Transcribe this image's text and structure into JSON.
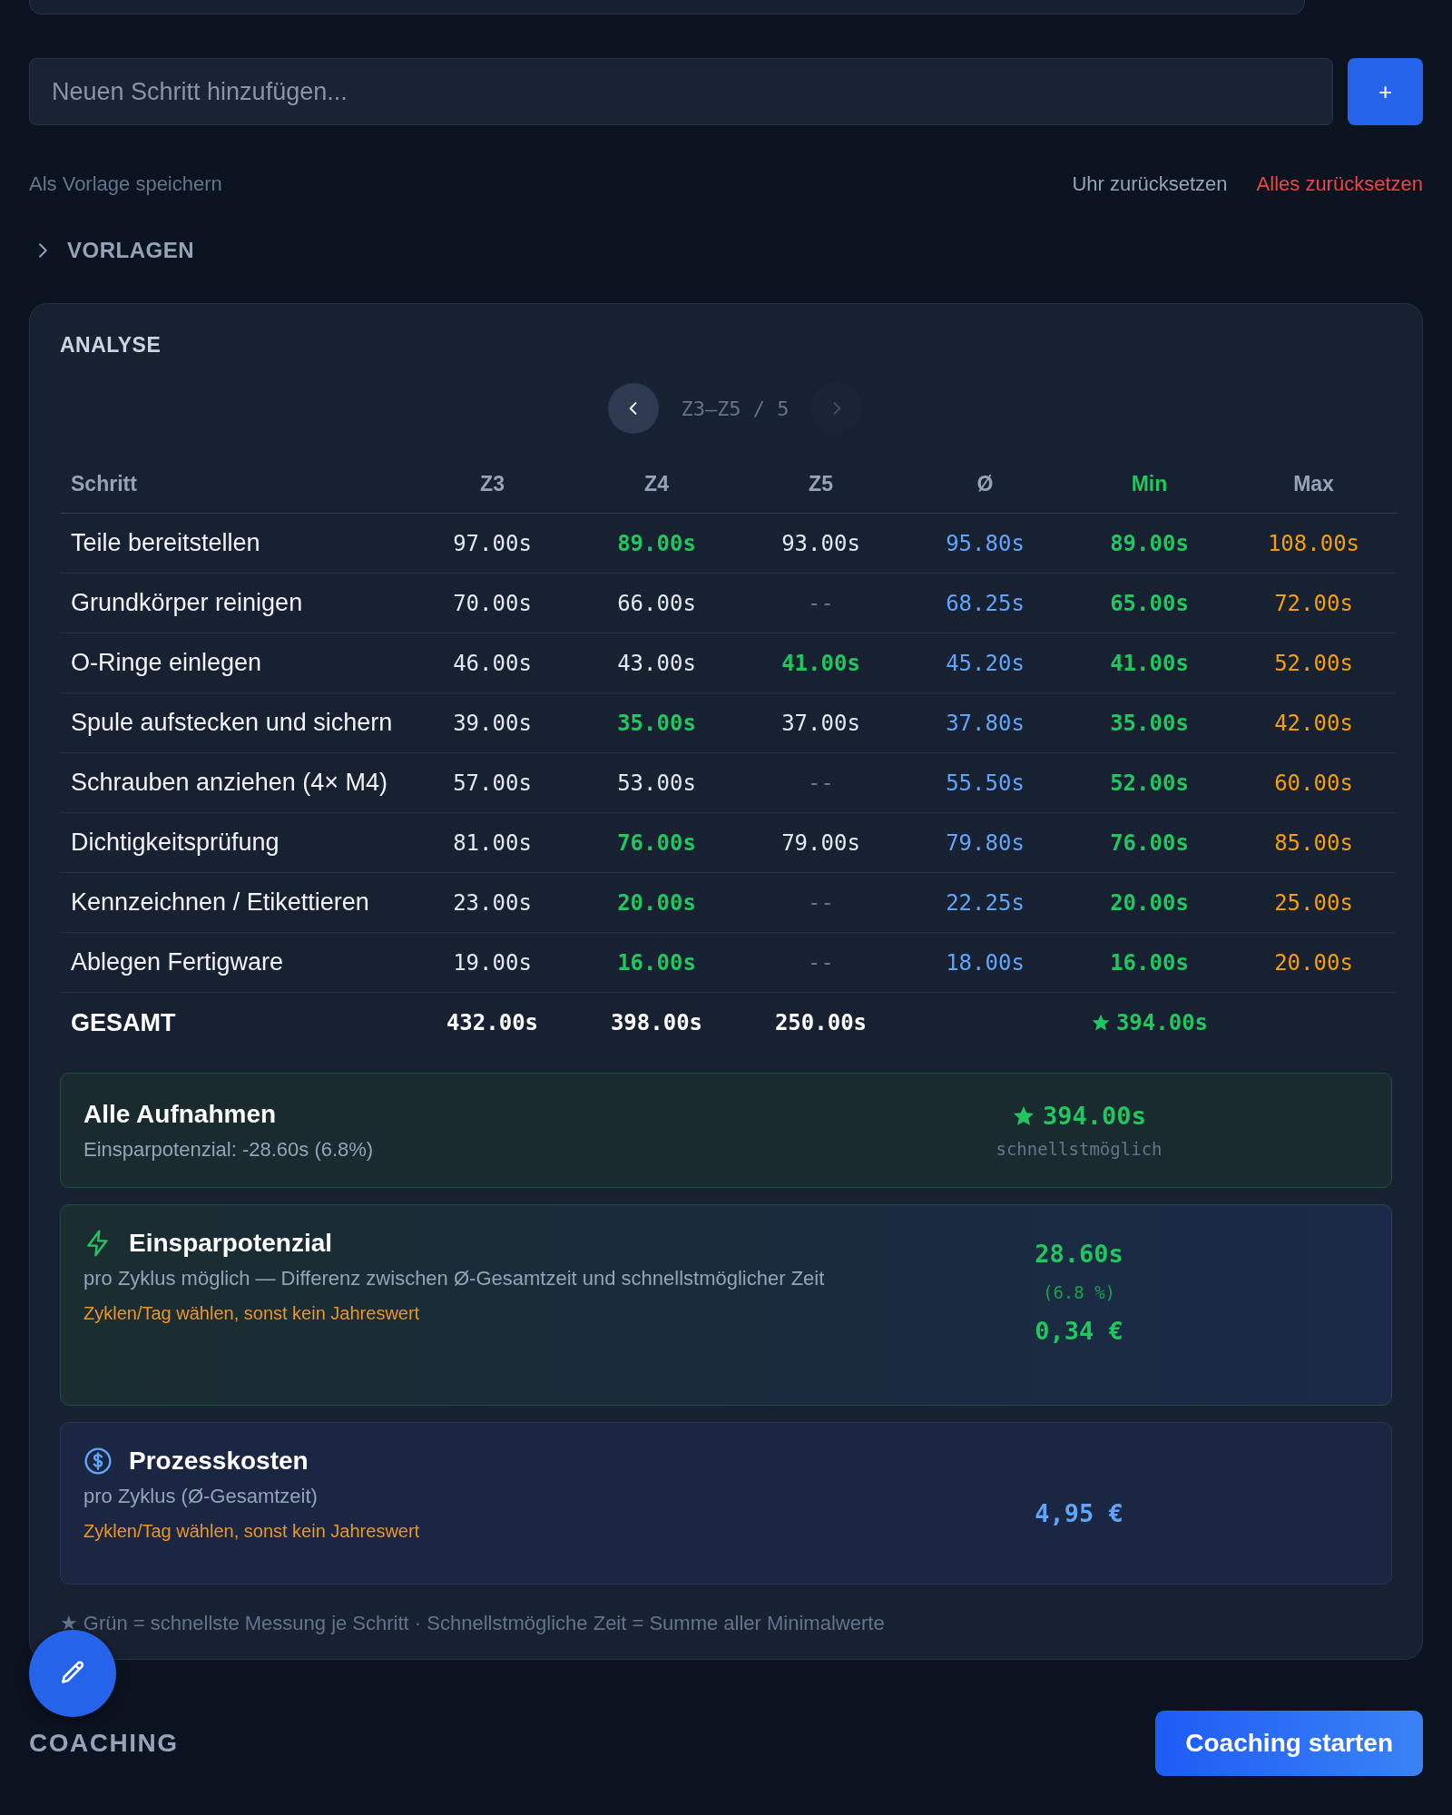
{
  "add_step": {
    "placeholder": "Neuen Schritt hinzufügen...",
    "button": "+"
  },
  "actions": {
    "save_template": "Als Vorlage speichern",
    "reset_clock": "Uhr zurücksetzen",
    "reset_all": "Alles zurücksetzen"
  },
  "templates": {
    "label": "VORLAGEN",
    "expanded": false
  },
  "analysis": {
    "title": "ANALYSE",
    "pager": {
      "label": "Z3–Z5 / 5",
      "prev_disabled": false,
      "next_disabled": true
    },
    "columns": [
      "Schritt",
      "Z3",
      "Z4",
      "Z5",
      "Ø",
      "Min",
      "Max"
    ],
    "rows": [
      [
        {
          "kind": "step",
          "text": "Teile bereitstellen"
        },
        {
          "kind": "time",
          "text": "97.00s",
          "best": false,
          "empty": false
        },
        {
          "kind": "time",
          "text": "89.00s",
          "best": true,
          "empty": false
        },
        {
          "kind": "time",
          "text": "93.00s",
          "best": false,
          "empty": false
        },
        {
          "kind": "avg",
          "text": "95.80s"
        },
        {
          "kind": "min",
          "text": "89.00s"
        },
        {
          "kind": "max",
          "text": "108.00s"
        }
      ],
      [
        {
          "kind": "step",
          "text": "Grundkörper reinigen"
        },
        {
          "kind": "time",
          "text": "70.00s",
          "best": false,
          "empty": false
        },
        {
          "kind": "time",
          "text": "66.00s",
          "best": false,
          "empty": false
        },
        {
          "kind": "time",
          "text": "--",
          "best": false,
          "empty": true
        },
        {
          "kind": "avg",
          "text": "68.25s"
        },
        {
          "kind": "min",
          "text": "65.00s"
        },
        {
          "kind": "max",
          "text": "72.00s"
        }
      ],
      [
        {
          "kind": "step",
          "text": "O-Ringe einlegen"
        },
        {
          "kind": "time",
          "text": "46.00s",
          "best": false,
          "empty": false
        },
        {
          "kind": "time",
          "text": "43.00s",
          "best": false,
          "empty": false
        },
        {
          "kind": "time",
          "text": "41.00s",
          "best": true,
          "empty": false
        },
        {
          "kind": "avg",
          "text": "45.20s"
        },
        {
          "kind": "min",
          "text": "41.00s"
        },
        {
          "kind": "max",
          "text": "52.00s"
        }
      ],
      [
        {
          "kind": "step",
          "text": "Spule aufstecken und sichern"
        },
        {
          "kind": "time",
          "text": "39.00s",
          "best": false,
          "empty": false
        },
        {
          "kind": "time",
          "text": "35.00s",
          "best": true,
          "empty": false
        },
        {
          "kind": "time",
          "text": "37.00s",
          "best": false,
          "empty": false
        },
        {
          "kind": "avg",
          "text": "37.80s"
        },
        {
          "kind": "min",
          "text": "35.00s"
        },
        {
          "kind": "max",
          "text": "42.00s"
        }
      ],
      [
        {
          "kind": "step",
          "text": "Schrauben anziehen (4× M4)"
        },
        {
          "kind": "time",
          "text": "57.00s",
          "best": false,
          "empty": false
        },
        {
          "kind": "time",
          "text": "53.00s",
          "best": false,
          "empty": false
        },
        {
          "kind": "time",
          "text": "--",
          "best": false,
          "empty": true
        },
        {
          "kind": "avg",
          "text": "55.50s"
        },
        {
          "kind": "min",
          "text": "52.00s"
        },
        {
          "kind": "max",
          "text": "60.00s"
        }
      ],
      [
        {
          "kind": "step",
          "text": "Dichtigkeitsprüfung"
        },
        {
          "kind": "time",
          "text": "81.00s",
          "best": false,
          "empty": false
        },
        {
          "kind": "time",
          "text": "76.00s",
          "best": true,
          "empty": false
        },
        {
          "kind": "time",
          "text": "79.00s",
          "best": false,
          "empty": false
        },
        {
          "kind": "avg",
          "text": "79.80s"
        },
        {
          "kind": "min",
          "text": "76.00s"
        },
        {
          "kind": "max",
          "text": "85.00s"
        }
      ],
      [
        {
          "kind": "step",
          "text": "Kennzeichnen / Etikettieren"
        },
        {
          "kind": "time",
          "text": "23.00s",
          "best": false,
          "empty": false
        },
        {
          "kind": "time",
          "text": "20.00s",
          "best": true,
          "empty": false
        },
        {
          "kind": "time",
          "text": "--",
          "best": false,
          "empty": true
        },
        {
          "kind": "avg",
          "text": "22.25s"
        },
        {
          "kind": "min",
          "text": "20.00s"
        },
        {
          "kind": "max",
          "text": "25.00s"
        }
      ],
      [
        {
          "kind": "step",
          "text": "Ablegen Fertigware"
        },
        {
          "kind": "time",
          "text": "19.00s",
          "best": false,
          "empty": false
        },
        {
          "kind": "time",
          "text": "16.00s",
          "best": true,
          "empty": false
        },
        {
          "kind": "time",
          "text": "--",
          "best": false,
          "empty": true
        },
        {
          "kind": "avg",
          "text": "18.00s"
        },
        {
          "kind": "min",
          "text": "16.00s"
        },
        {
          "kind": "max",
          "text": "20.00s"
        }
      ]
    ],
    "total": {
      "label": "GESAMT",
      "values": [
        "432.00s",
        "398.00s",
        "250.00s"
      ],
      "min": "394.00s"
    },
    "summary": {
      "title": "Alle Aufnahmen",
      "subtitle": "Einsparpotenzial: -28.60s (6.8%)",
      "value": "394.00s",
      "caption": "schnellstmöglich"
    },
    "savings": {
      "title": "Einsparpotenzial",
      "text": "pro Zyklus möglich — Differenz zwischen Ø-Gesamtzeit und schnellstmöglicher Zeit",
      "hint": "Zyklen/Tag wählen, sonst kein Jahreswert",
      "value": "28.60s",
      "percent": "(6.8 %)",
      "cost": "0,34 €"
    },
    "costs": {
      "title": "Prozesskosten",
      "text": "pro Zyklus (Ø-Gesamtzeit)",
      "hint": "Zyklen/Tag wählen, sonst kein Jahreswert",
      "value": "4,95 €"
    },
    "footnote": "★ Grün = schnellste Messung je Schritt · Schnellstmögliche Zeit = Summe aller Minimalwerte"
  },
  "coaching": {
    "label": "COACHING",
    "button": "Coaching starten"
  }
}
